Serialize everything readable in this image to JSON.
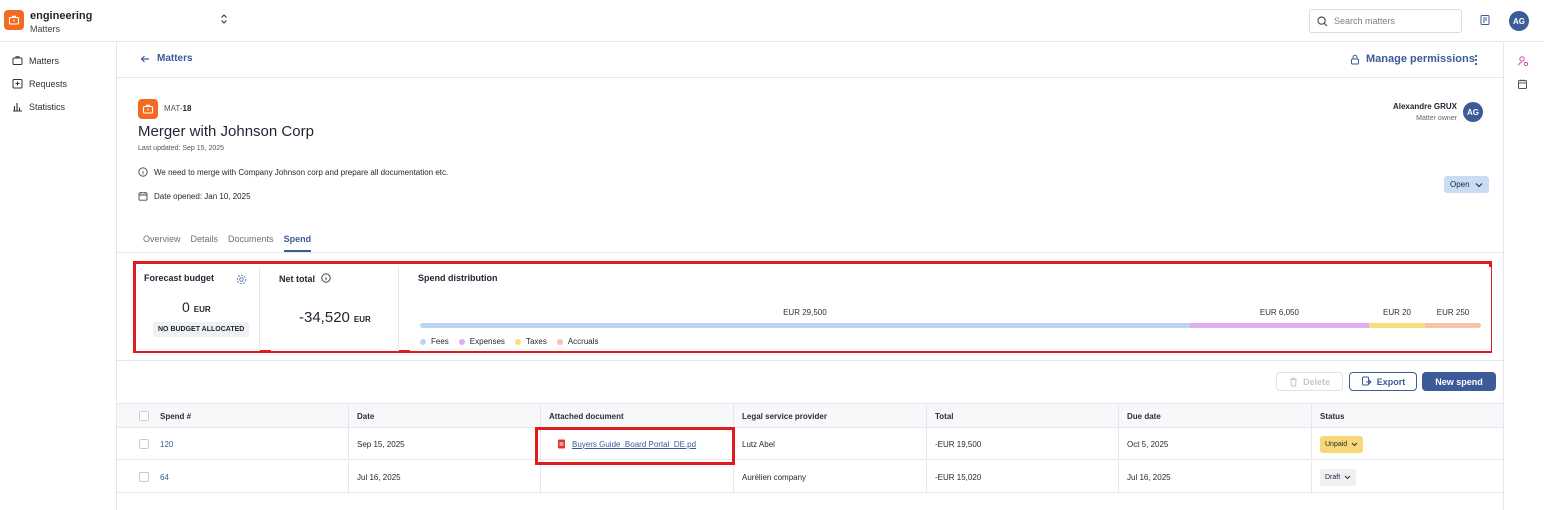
{
  "workspace": {
    "name": "engineering",
    "section": "Matters"
  },
  "search": {
    "placeholder": "Search matters"
  },
  "user": {
    "initials": "AG"
  },
  "sidebar": {
    "items": [
      {
        "label": "Matters"
      },
      {
        "label": "Requests"
      },
      {
        "label": "Statistics"
      }
    ]
  },
  "header": {
    "back_label": "Matters",
    "manage_label": "Manage permissions"
  },
  "matter": {
    "id_prefix": "MAT-",
    "id_number": "18",
    "title": "Merger with Johnson Corp",
    "last_updated": "Last updated: Sep 15, 2025",
    "description": "We need to merge with Company Johnson corp and prepare all documentation etc.",
    "date_opened": "Date opened: Jan 10, 2025",
    "owner_name": "Alexandre GRUX",
    "owner_role": "Matter owner",
    "owner_initials": "AG",
    "status": "Open"
  },
  "tabs": [
    "Overview",
    "Details",
    "Documents",
    "Spend"
  ],
  "active_tab": "Spend",
  "forecast": {
    "title": "Forecast budget",
    "value": "0",
    "currency": "EUR",
    "badge": "NO BUDGET ALLOCATED"
  },
  "net_total": {
    "title": "Net total",
    "value": "-34,520",
    "currency": "EUR"
  },
  "spend_distribution": {
    "title": "Spend distribution",
    "segments": [
      {
        "name": "Fees",
        "label": "EUR 29,500",
        "value": 29500,
        "color": "#bcd6f3"
      },
      {
        "name": "Expenses",
        "label": "EUR 6,050",
        "value": 6050,
        "color": "#dfaef0"
      },
      {
        "name": "Taxes",
        "label": "EUR 20",
        "value": 20,
        "color": "#f7de7e"
      },
      {
        "name": "Accruals",
        "label": "EUR 250",
        "value": 250,
        "color": "#f6c2a8"
      }
    ]
  },
  "toolbar": {
    "delete_label": "Delete",
    "export_label": "Export",
    "new_label": "New spend"
  },
  "table": {
    "columns": [
      "Spend #",
      "Date",
      "Attached document",
      "Legal service provider",
      "Total",
      "Due date",
      "Status"
    ],
    "rows": [
      {
        "spend": "120",
        "date": "Sep 15, 2025",
        "document": "Buyers Guide_Board Portal_DE.pd",
        "provider": "Lutz Abel",
        "total": "-EUR 19,500",
        "due": "Oct 5, 2025",
        "status": "Unpaid"
      },
      {
        "spend": "64",
        "date": "Jul 16, 2025",
        "document": "",
        "provider": "Aurélien company",
        "total": "-EUR 15,020",
        "due": "Jul 16, 2025",
        "status": "Draft"
      }
    ]
  }
}
